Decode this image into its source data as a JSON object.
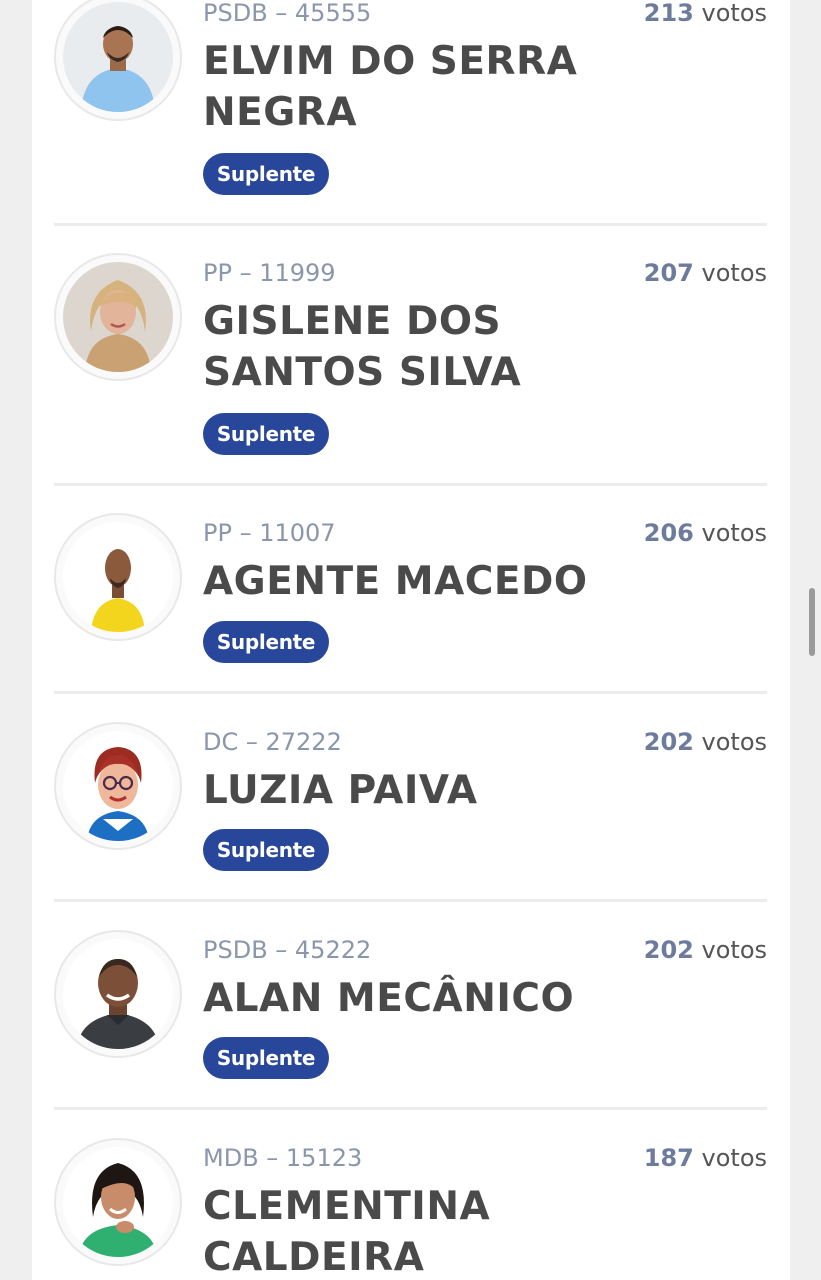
{
  "candidates": [
    {
      "party": "PSDB – 45555",
      "votes": "213",
      "votes_unit": "votos",
      "name": "ELVIM DO SERRA NEGRA",
      "status": "Suplente"
    },
    {
      "party": "PP – 11999",
      "votes": "207",
      "votes_unit": "votos",
      "name": "GISLENE DOS SANTOS SILVA",
      "status": "Suplente"
    },
    {
      "party": "PP – 11007",
      "votes": "206",
      "votes_unit": "votos",
      "name": "AGENTE MACEDO",
      "status": "Suplente"
    },
    {
      "party": "DC – 27222",
      "votes": "202",
      "votes_unit": "votos",
      "name": "LUZIA PAIVA",
      "status": "Suplente"
    },
    {
      "party": "PSDB – 45222",
      "votes": "202",
      "votes_unit": "votos",
      "name": "ALAN MECÂNICO",
      "status": "Suplente"
    },
    {
      "party": "MDB – 15123",
      "votes": "187",
      "votes_unit": "votos",
      "name": "CLEMENTINA CALDEIRA",
      "status": ""
    }
  ],
  "colors": {
    "badge": "#28479a",
    "party_text": "#8a96ab",
    "vote_number": "#6d7c9c",
    "name_text": "#4a4a4a"
  }
}
